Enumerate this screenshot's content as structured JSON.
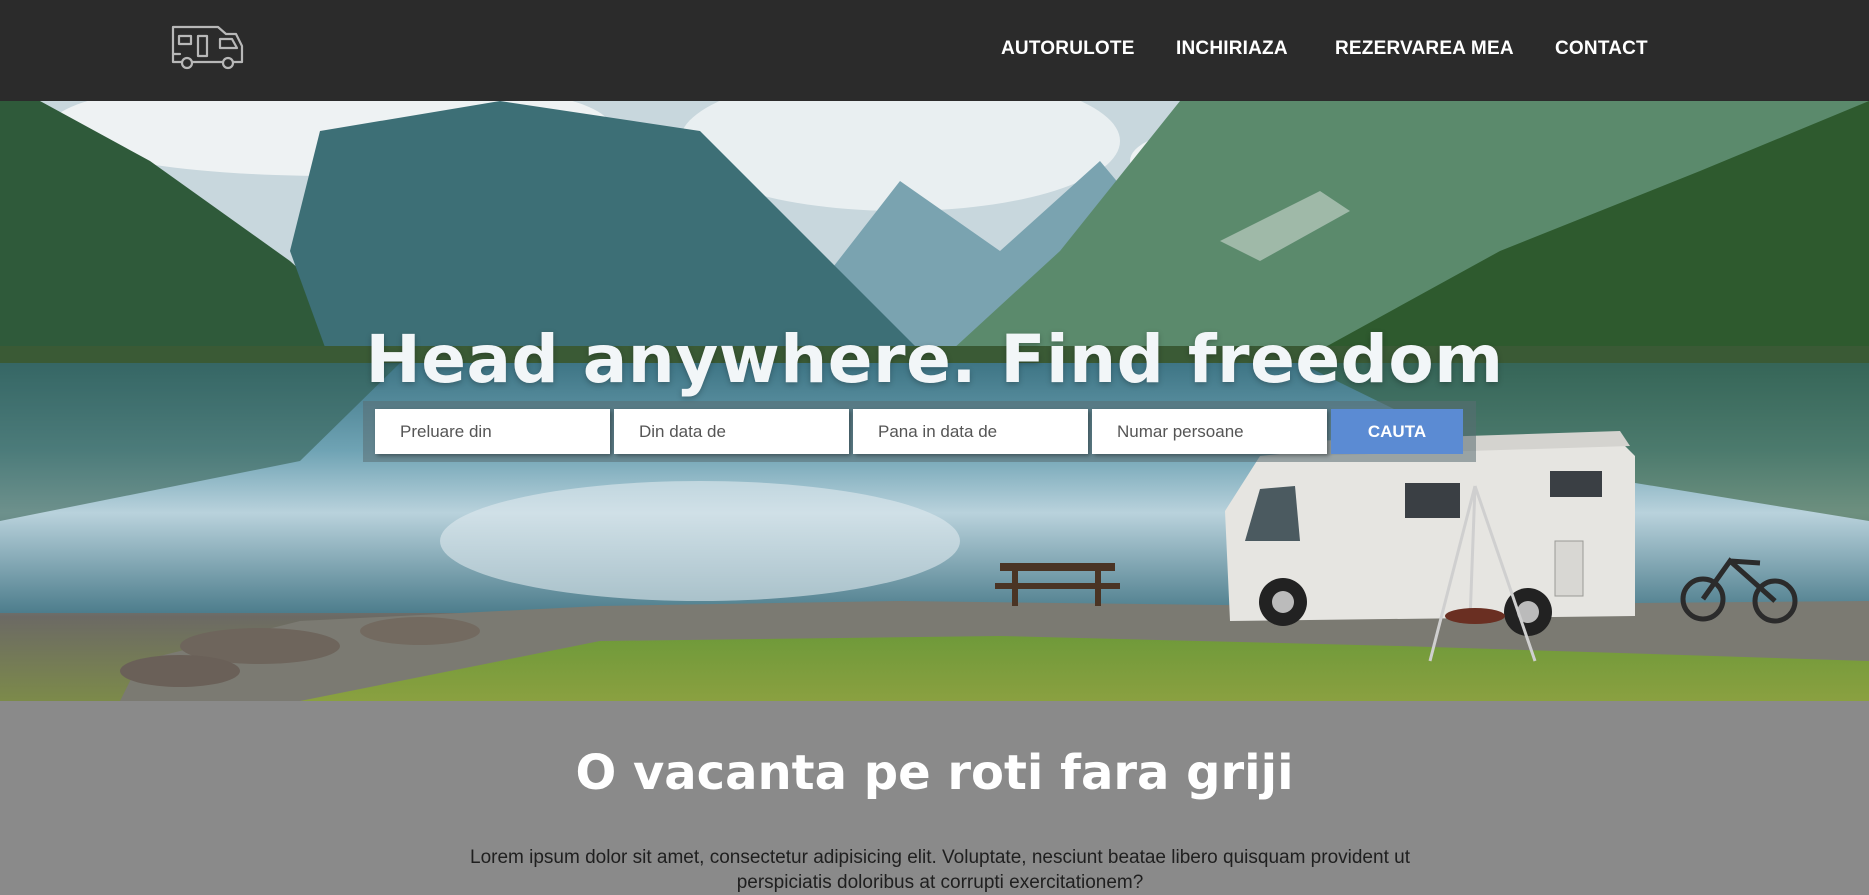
{
  "header": {
    "logo": "camper-van-icon",
    "nav": [
      {
        "label": "AUTORULOTE"
      },
      {
        "label": "INCHIRIAZA"
      },
      {
        "label": "REZERVAREA MEA"
      },
      {
        "label": "CONTACT"
      }
    ]
  },
  "hero": {
    "title": "Head anywhere. Find freedom",
    "search": {
      "pickup_placeholder": "Preluare din",
      "from_date_placeholder": "Din data de",
      "to_date_placeholder": "Pana in data de",
      "persons_placeholder": "Numar persoane",
      "button_label": "CAUTA"
    }
  },
  "intro": {
    "title": "O vacanta pe roti fara griji",
    "text": "Lorem ipsum dolor sit amet, consectetur adipisicing elit. Voluptate, nesciunt beatae libero quisquam provident ut perspiciatis doloribus at corrupti exercitationem?"
  },
  "colors": {
    "header_bg": "#2b2b2b",
    "search_button": "#5b8bd3",
    "section_bg": "#8a8a8a"
  }
}
